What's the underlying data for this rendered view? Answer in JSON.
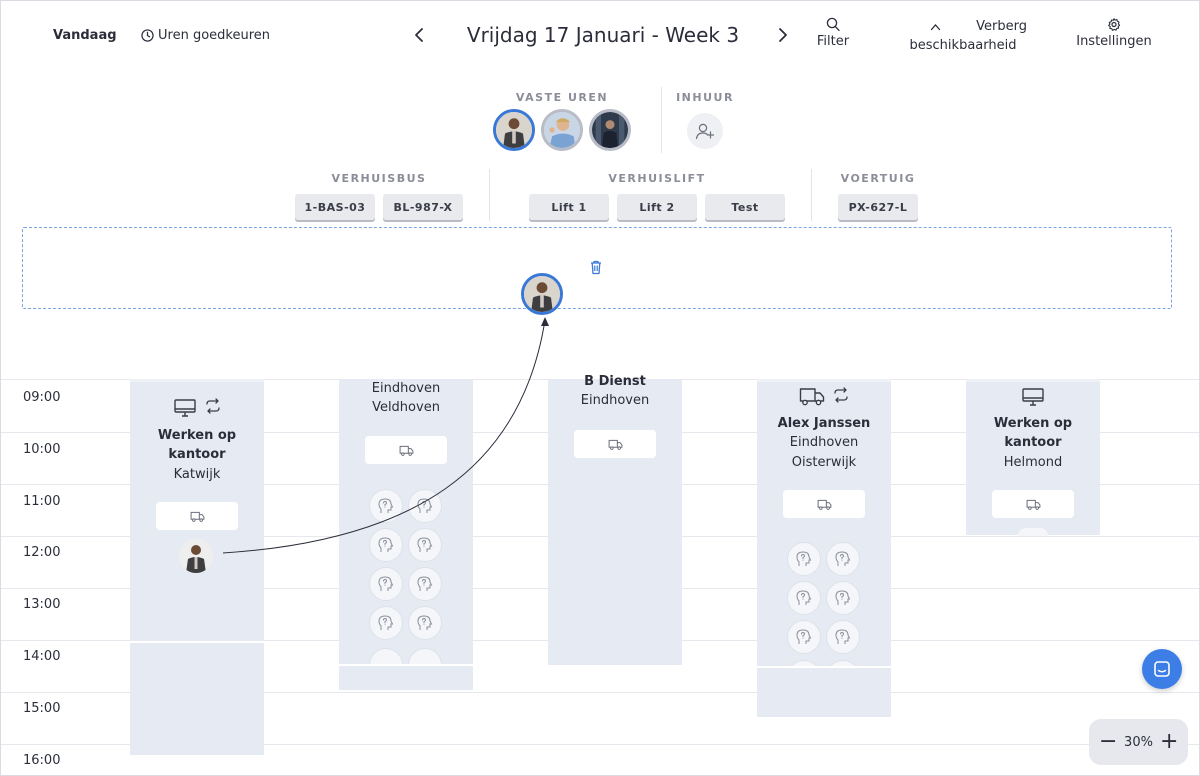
{
  "topbar": {
    "today_label": "Vandaag",
    "approve_label": "Uren goedkeuren",
    "date_title": "Vrijdag 17 Januari - Week 3",
    "filter_label": "Filter",
    "hide_label_1": "Verberg",
    "hide_label_2": "beschikbaarheid",
    "settings_label": "Instellingen"
  },
  "staff": {
    "fixed_label": "VASTE UREN",
    "hire_label": "INHUUR"
  },
  "resources": {
    "bus_label": "VERHUISBUS",
    "lift_label": "VERHUISLIFT",
    "vehicle_label": "VOERTUIG",
    "buses": [
      "1-BAS-03",
      "BL-987-X"
    ],
    "lifts": [
      "Lift 1",
      "Lift 2",
      "Test"
    ],
    "vehicles": [
      "PX-627-L"
    ]
  },
  "times": [
    "09:00",
    "10:00",
    "11:00",
    "12:00",
    "13:00",
    "14:00",
    "15:00",
    "16:00"
  ],
  "columns": [
    {
      "line1": "Werken op",
      "line2": "kantoor",
      "line3": "Katwijk"
    },
    {
      "line1": "Eindhoven",
      "line2": "Veldhoven"
    },
    {
      "line1": "B Dienst",
      "line2": "Eindhoven"
    },
    {
      "line1": "Alex Janssen",
      "line2": "Eindhoven",
      "line3": "Oisterwijk"
    },
    {
      "line1": "Werken op",
      "line2": "kantoor",
      "line3": "Helmond"
    }
  ],
  "zoom": {
    "value": "30%",
    "minus": "−",
    "plus": "+"
  },
  "colors": {
    "accent": "#3a78d8",
    "column_bg": "#e6ebf3",
    "chat": "#3d7ee6"
  }
}
